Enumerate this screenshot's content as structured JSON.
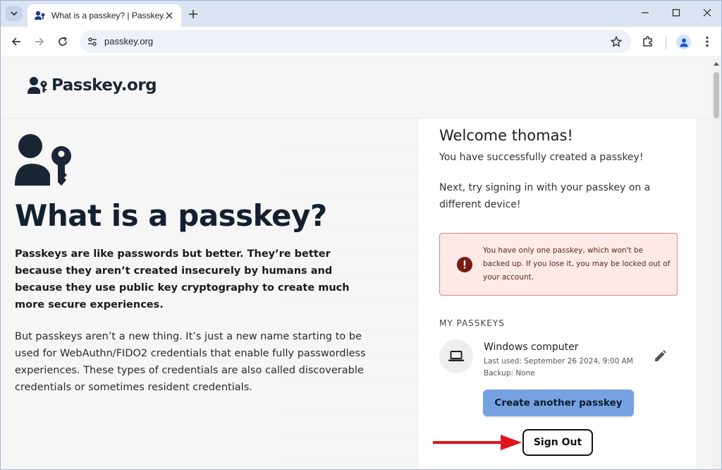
{
  "browser": {
    "tab_title": "What is a passkey? | Passkey.org",
    "url": "passkey.org"
  },
  "site": {
    "logo_text": "Passkey.org"
  },
  "hero": {
    "title": "What is a passkey?",
    "lead": "Passkeys are like passwords but better. They’re better because they aren’t created insecurely by humans and because they use public key cryptography to create much more secure experiences.",
    "body": "But passkeys aren’t a new thing. It’s just a new name starting to be used for WebAuthn/FIDO2 credentials that enable fully passwordless experiences. These types of credentials are also called discoverable credentials or sometimes resident credentials."
  },
  "panel": {
    "welcome": "Welcome thomas!",
    "success": "You have successfully created a passkey!",
    "next": "Next, try signing in with your passkey on a different device!",
    "warning": "You have only one passkey, which won't be backed up. If you lose it, you may be locked out of your account.",
    "section_label": "MY PASSKEYS",
    "passkey": {
      "name": "Windows computer",
      "last_used": "Last used: September 26 2024, 9:00 AM",
      "backup": "Backup: None"
    },
    "create_button": "Create another passkey",
    "signout_button": "Sign Out"
  },
  "colors": {
    "accent_button": "#76a2e2",
    "warning_bg": "#fde9e5",
    "warning_border": "#e0876c",
    "annotation_arrow": "#e0141c"
  },
  "icons": {
    "tab_search": "chevron-down-icon",
    "favicon": "passkey-favicon-icon",
    "close": "close-icon",
    "new_tab": "plus-icon",
    "back": "arrow-left-icon",
    "forward": "arrow-right-icon",
    "reload": "reload-icon",
    "site_info": "tune-icon",
    "bookmark": "star-icon",
    "extensions": "puzzle-icon",
    "profile": "person-icon",
    "menu": "kebab-menu-icon",
    "warning": "exclamation-circle-icon",
    "laptop": "laptop-icon",
    "edit": "pencil-icon"
  }
}
